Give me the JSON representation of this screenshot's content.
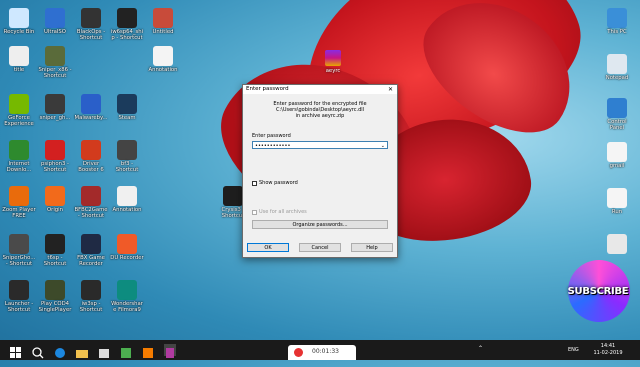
{
  "desktop_icons": [
    {
      "id": "recycle-bin",
      "label": "Recycle Bin",
      "color": "#cfe8ff"
    },
    {
      "id": "ultraiso",
      "label": "UltraISO",
      "color": "#2f6fd0"
    },
    {
      "id": "blackops",
      "label": "BlackOps - Shortcut",
      "color": "#333333"
    },
    {
      "id": "iw6sp64",
      "label": "iw6sp64_ship - Shortcut",
      "color": "#222222"
    },
    {
      "id": "untitled",
      "label": "Untitled",
      "color": "#c84b3a"
    },
    {
      "id": "title",
      "label": "title",
      "color": "#eeeeee"
    },
    {
      "id": "sniper-x86",
      "label": "Sniper_x86 - Shortcut",
      "color": "#5a6b3a"
    },
    {
      "id": "annotation1",
      "label": "Annotation",
      "color": "#f4f4f4"
    },
    {
      "id": "geforce",
      "label": "GeForce Experience",
      "color": "#76b900"
    },
    {
      "id": "sniper-gh",
      "label": "sniper_gh...",
      "color": "#3a3a3a"
    },
    {
      "id": "malwarebytes",
      "label": "Malwareby...",
      "color": "#2a5fc9"
    },
    {
      "id": "steam",
      "label": "Steam",
      "color": "#1b3b5c"
    },
    {
      "id": "idm",
      "label": "Internet Downlo...",
      "color": "#2e8a2e"
    },
    {
      "id": "psiphon",
      "label": "psiphon3 - Shortcut",
      "color": "#d32020"
    },
    {
      "id": "driver-booster",
      "label": "Driver Booster 6",
      "color": "#d23b1d"
    },
    {
      "id": "bf3",
      "label": "bf3 - Shortcut",
      "color": "#444444"
    },
    {
      "id": "zoom-player",
      "label": "Zoom Player FREE",
      "color": "#e96b0c"
    },
    {
      "id": "origin",
      "label": "Origin",
      "color": "#f26a1b"
    },
    {
      "id": "bfbc2",
      "label": "BFBC2Game - Shortcut",
      "color": "#a32a2a"
    },
    {
      "id": "annotation2",
      "label": "Annotation",
      "color": "#f0f0f0"
    },
    {
      "id": "crysis3",
      "label": "Crysis3 - Shortcut",
      "color": "#1e1e1e"
    },
    {
      "id": "snipergho",
      "label": "SniperGho... - Shortcut",
      "color": "#4a4a4a"
    },
    {
      "id": "t6sp",
      "label": "t6sp - Shortcut",
      "color": "#222222"
    },
    {
      "id": "fbx",
      "label": "FBX Game Recorder",
      "color": "#1f2a44"
    },
    {
      "id": "du-recorder",
      "label": "DU Recorder",
      "color": "#f05a28"
    },
    {
      "id": "launcher",
      "label": "Launcher - Shortcut",
      "color": "#2a2a2a"
    },
    {
      "id": "play-cod4",
      "label": "Play COD4 SinglePlayer",
      "color": "#3d4a2a"
    },
    {
      "id": "iw3sp",
      "label": "iw3sp - Shortcut",
      "color": "#2a2a2a"
    },
    {
      "id": "filmora",
      "label": "Wondershare Filmora9",
      "color": "#0d8c7f"
    },
    {
      "id": "this-pc",
      "label": "This PC",
      "color": "#3a8fd8"
    },
    {
      "id": "notepad",
      "label": "Notepad",
      "color": "#dfe8f0"
    },
    {
      "id": "control-panel",
      "label": "Control Panel",
      "color": "#2f7fd0"
    },
    {
      "id": "gmail",
      "label": "gmail",
      "color": "#f5f5f5"
    },
    {
      "id": "run",
      "label": "Run",
      "color": "#f5f5f5"
    },
    {
      "id": "app-right",
      "label": "",
      "color": "#e8e8e8"
    }
  ],
  "archive_file": {
    "label": "aeyrc"
  },
  "dialog": {
    "title": "Enter password",
    "info_line1": "Enter password for the encrypted file",
    "info_line2": "C:\\Users\\gobinda\\Desktop\\aeyrc.dll",
    "info_line3": "in archive aeyrc.zip",
    "field_label": "Enter password",
    "password_mask": "••••••••••••",
    "show_password": "Show password",
    "use_for_all": "Use for all archives",
    "organize": "Organize passwords...",
    "ok": "OK",
    "cancel": "Cancel",
    "help": "Help"
  },
  "badge": {
    "text": "SUBSCRIBE"
  },
  "recorder": {
    "time": "00:01:33"
  },
  "tray": {
    "lang": "ENG",
    "time": "14:41",
    "date": "11-02-2019"
  },
  "colors": {
    "accent": "#0078d7",
    "taskbar": "#1a1a1a",
    "record": "#e63232"
  }
}
